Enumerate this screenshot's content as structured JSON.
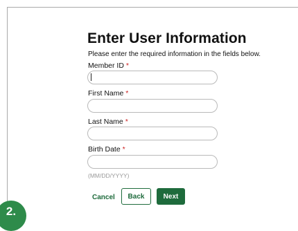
{
  "form": {
    "title": "Enter User Information",
    "instructions": "Please enter the required information in the fields below.",
    "required_marker": "*",
    "fields": [
      {
        "label": "Member ID",
        "value": ""
      },
      {
        "label": "First Name",
        "value": ""
      },
      {
        "label": "Last Name",
        "value": ""
      },
      {
        "label": "Birth Date",
        "value": "",
        "hint": "(MM/DD/YYYY)"
      }
    ]
  },
  "actions": {
    "cancel": "Cancel",
    "back": "Back",
    "next": "Next"
  },
  "step_badge": "2.",
  "colors": {
    "brand_green": "#1e6b3c",
    "badge_green": "#2e8b4a",
    "required_red": "#cc2222"
  }
}
